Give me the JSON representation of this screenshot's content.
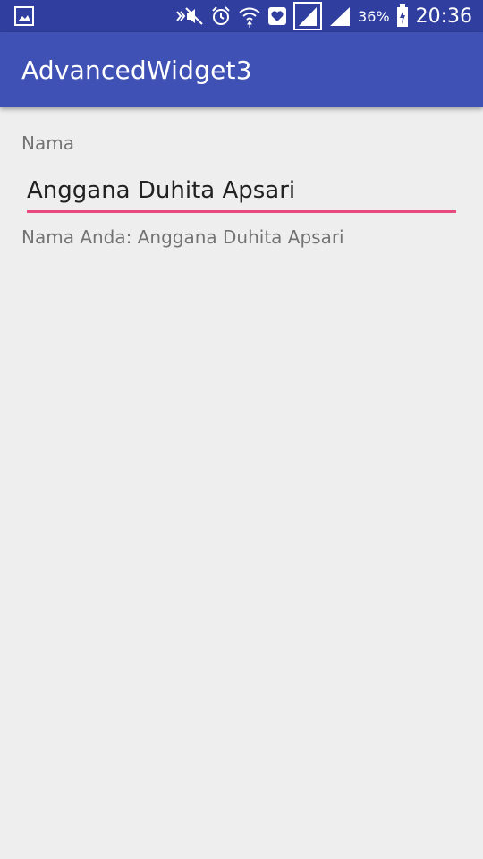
{
  "status_bar": {
    "battery_percent": "36%",
    "time": "20:36",
    "icons": [
      "gallery-icon",
      "vibrate-silent-icon",
      "alarm-icon",
      "wifi-icon",
      "health-icon",
      "signal-sim1-icon",
      "signal-sim2-icon",
      "battery-charging-icon"
    ]
  },
  "app_bar": {
    "title": "AdvancedWidget3",
    "color": "#3f51b5"
  },
  "form": {
    "label": "Nama",
    "input_value": "Anggana Duhita Apsari",
    "underline_color": "#e8497e",
    "result_text": "Nama Anda: Anggana Duhita Apsari"
  }
}
